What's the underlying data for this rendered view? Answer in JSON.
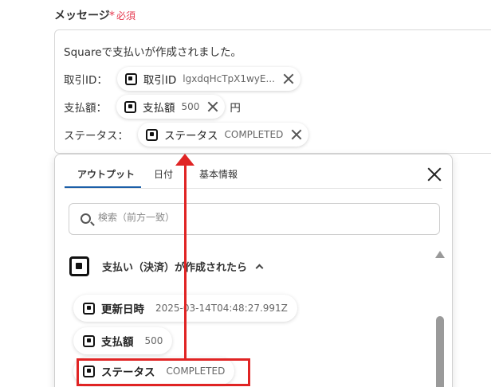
{
  "message_field": {
    "label": "メッセージ",
    "required": "必須",
    "line1": "Squareで支払いが作成されました。",
    "rows": [
      {
        "label": "取引ID：",
        "chip_label": "取引ID",
        "chip_value": "lgxdqHcTpX1wyE...",
        "suffix": ""
      },
      {
        "label": "支払額：",
        "chip_label": "支払額",
        "chip_value": "500",
        "suffix": "円"
      },
      {
        "label": "ステータス：",
        "chip_label": "ステータス",
        "chip_value": "COMPLETED",
        "suffix": ""
      }
    ]
  },
  "picker": {
    "tabs": [
      "アウトプット",
      "日付",
      "基本情報"
    ],
    "active_tab": 0,
    "search_placeholder": "検索（前方一致）",
    "group_title": "支払い（決済）が作成されたら",
    "items": [
      {
        "label": "更新日時",
        "value": "2025-03-14T04:48:27.991Z"
      },
      {
        "label": "支払額",
        "value": "500"
      },
      {
        "label": "ステータス",
        "value": "COMPLETED"
      }
    ]
  },
  "icons": {
    "service": "square-logo-icon",
    "remove": "close-icon",
    "search": "search-icon",
    "collapse": "chevron-up-icon",
    "scroll": "scroll-up-arrow-icon"
  },
  "colors": {
    "required": "#e5394f",
    "tab_active": "#1c5fa8",
    "annotation": "#e02424"
  }
}
